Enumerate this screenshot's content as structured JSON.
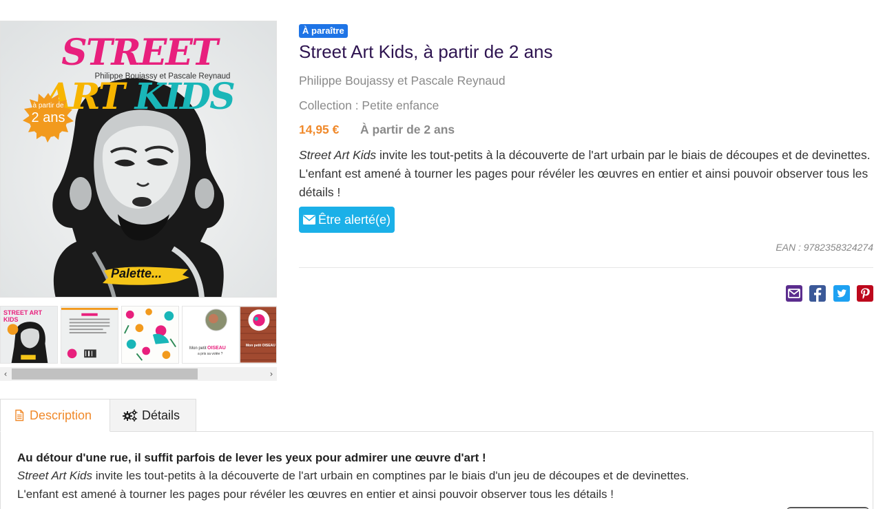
{
  "cover": {
    "title_w1": "STREET",
    "title_w2": "ART",
    "title_w3": "KIDS",
    "authors": "Philippe Boujassy et Pascale Reynaud",
    "badge_line1": "à partir de",
    "badge_line2": "2 ans",
    "brand": "Palette..."
  },
  "thumbnails": [
    {
      "alt": "Couverture"
    },
    {
      "alt": "Quatrième de couverture"
    },
    {
      "alt": "Motif floral"
    },
    {
      "alt": "Mon petit OISEAU"
    },
    {
      "alt": "Page mur de briques"
    }
  ],
  "thumb_texts": {
    "t1_title": "STREET ART KIDS",
    "t4_text1": "Mon petit",
    "t4_text2": "OISEAU",
    "t4_text3": "a pris sa volée ?",
    "t5_text": "Mon petit OISEAU"
  },
  "product": {
    "status_badge": "À paraître",
    "title": "Street Art Kids, à partir de 2 ans",
    "authors": "Philippe Boujassy et Pascale Reynaud",
    "collection": "Collection : Petite enfance",
    "price": "14,95 €",
    "age": "À partir de 2 ans",
    "summary_italic": "Street Art Kids",
    "summary_rest": " invite les tout-petits à la découverte de l'art urbain par le biais de découpes et de devinettes. L'enfant est amené à tourner les pages pour révéler les œuvres en entier et ainsi pouvoir observer tous les détails !",
    "alert_button": "Être alerté(e)",
    "ean": "EAN : 9782358324274"
  },
  "share": {
    "email_icon": "envelope-square-icon",
    "facebook_icon": "facebook-square-icon",
    "twitter_icon": "twitter-square-icon",
    "pinterest_icon": "pinterest-square-icon"
  },
  "tabs": {
    "description": "Description",
    "details": "Détails"
  },
  "description_panel": {
    "heading": "Au détour d'une rue, il suffit parfois de lever les yeux pour admirer une œuvre d'art !",
    "italic": "Street Art Kids",
    "line1_rest": " invite les tout-petits à la découverte de l'art urbain en comptines par le biais d'un jeu de découpes et de devinettes.",
    "line2": "L'enfant est amené à tourner les pages pour révéler les œuvres en entier et ainsi pouvoir observer tous les détails !"
  },
  "colors": {
    "accent_orange": "#f0892a",
    "badge_blue": "#1e74e6",
    "button_cyan": "#1bb0e8",
    "title_purple": "#2e1450",
    "email": "#5b2d8e",
    "facebook": "#3b5998",
    "twitter": "#1da1f2",
    "pinterest": "#bd081c"
  }
}
